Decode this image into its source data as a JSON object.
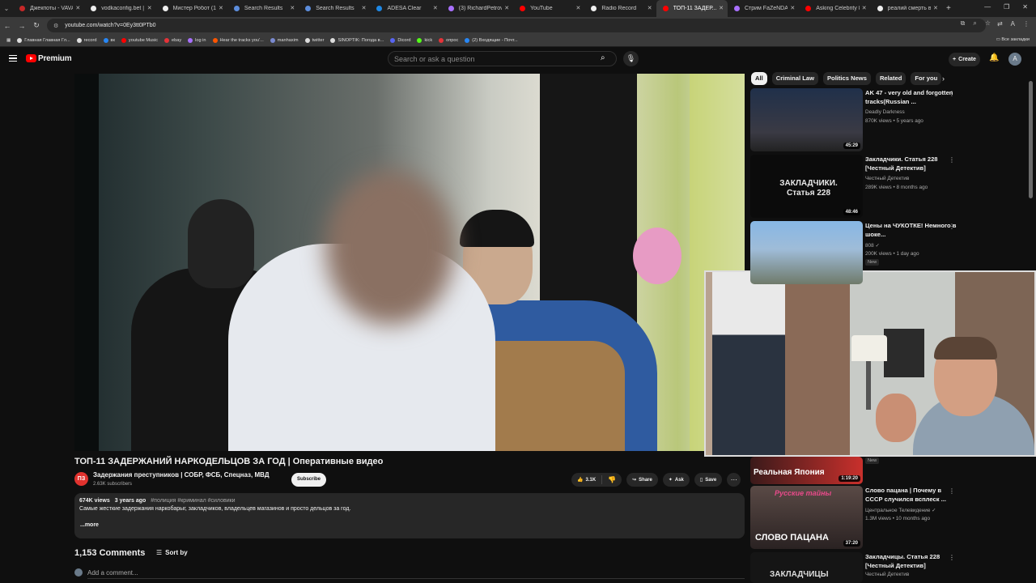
{
  "tabs": [
    {
      "label": "Джекпоты - VAVAD",
      "color": "#c62828"
    },
    {
      "label": "vodkaconfig.bet | 5...",
      "color": "#eee"
    },
    {
      "label": "Мистер Робот (1-4...",
      "color": "#eee"
    },
    {
      "label": "Search Results",
      "color": "#5c8ddc"
    },
    {
      "label": "Search Results",
      "color": "#5c8ddc"
    },
    {
      "label": "ADESA Clear",
      "color": "#1e88e5"
    },
    {
      "label": "(3) RichardPetrovic...",
      "color": "#a970ff"
    },
    {
      "label": "YouTube",
      "color": "#ff0000"
    },
    {
      "label": "Radio Record",
      "color": "#eee"
    },
    {
      "label": "ТОП-11 ЗАДЕР...",
      "color": "#ff0000"
    },
    {
      "label": "Стрим FaZeNDA67",
      "color": "#a970ff"
    },
    {
      "label": "Asking Celebrity 8...",
      "color": "#ff0000"
    },
    {
      "label": "реалий смерть в ...",
      "color": "#eee"
    }
  ],
  "address": {
    "url": "youtube.com/watch?v=0Ey3tt0PTb0"
  },
  "bookmarks": [
    {
      "label": "Главная Главная Гл...",
      "color": "#ddd"
    },
    {
      "label": "record",
      "color": "#ddd"
    },
    {
      "label": "вк",
      "color": "#2787f5"
    },
    {
      "label": "youtube Music",
      "color": "#ff0000"
    },
    {
      "label": "ebay",
      "color": "#e53238"
    },
    {
      "label": "log in",
      "color": "#a970ff"
    },
    {
      "label": "Hear the tracks you'...",
      "color": "#ff5500"
    },
    {
      "label": "manhaxim",
      "color": "#7a8ad0"
    },
    {
      "label": "twitter",
      "color": "#ddd"
    },
    {
      "label": "SINOPTIK: Погода в...",
      "color": "#ddd"
    },
    {
      "label": "Dicord",
      "color": "#5865f2"
    },
    {
      "label": "kick",
      "color": "#53fc18"
    },
    {
      "label": "опрос",
      "color": "#e53238"
    },
    {
      "label": "(2) Входящие - Почт...",
      "color": "#2787f5"
    }
  ],
  "bookmarks_all": "Все закладки",
  "header": {
    "logo_text": "Premium",
    "search_placeholder": "Search or ask a question",
    "create_label": "Create"
  },
  "video": {
    "title": "ТОП-11 ЗАДЕРЖАНИЙ НАРКОДЕЛЬЦОВ ЗА ГОД | Оперативные видео",
    "channel": "Задержания преступников | СОБР, ФСБ, Спецназ, МВД",
    "channel_abbr": "ПЗ",
    "subscribers": "2.63K subscribers",
    "subscribe_label": "Subscribe",
    "likes": "3.1K",
    "share_label": "Share",
    "ask_label": "Ask",
    "save_label": "Save",
    "views": "674K views",
    "age": "3 years ago",
    "tags": "#полиция #криминал #силовики",
    "description": "Самые жесткие задержания наркобарыг, закладчиков, владельцев магазинов и просто дельцов за год.",
    "more_label": "...more"
  },
  "comments": {
    "count": "1,153 Comments",
    "sort_label": "Sort by",
    "add_placeholder": "Add a comment..."
  },
  "chips": [
    {
      "label": "All",
      "active": true
    },
    {
      "label": "Criminal Law",
      "active": false
    },
    {
      "label": "Politics News",
      "active": false
    },
    {
      "label": "Related",
      "active": false
    },
    {
      "label": "For you",
      "active": false
    }
  ],
  "recommendations": [
    {
      "title": "AK 47 - very old and forgotten tracks(Russian ...",
      "channel": "Deadly Darkness",
      "meta": "870K views • 5 years ago",
      "duration": "45:29",
      "badge": ""
    },
    {
      "title": "Закладчики. Статья 228 [Честный Детектив]",
      "channel": "Честный Детектив",
      "meta": "289K views • 8 months ago",
      "duration": "48:46",
      "badge": "",
      "thumb_text": "ЗАКЛАДЧИКИ. Статья 228"
    },
    {
      "title": "Цены на ЧУКОТКЕ! Немного в шоке...",
      "channel": "808 ✓",
      "meta": "200K views • 1 day ago",
      "duration": "",
      "badge": "New"
    },
    {
      "title": "",
      "channel": "",
      "meta": "",
      "duration": "1:19:20",
      "badge": "New",
      "thumb_text": "Реальная Япония"
    },
    {
      "title": "Слово пацана | Почему в СССР случился всплеск ...",
      "channel": "Центральное Телевидение ✓",
      "meta": "1.3M views • 10 months ago",
      "duration": "37:20",
      "badge": "",
      "thumb_text": "СЛОВО ПАЦАНА",
      "thumb_text2": "Русские тайны"
    },
    {
      "title": "Закладчицы. Статья 228 [Честный Детектив]",
      "channel": "Честный Детектив",
      "meta": "",
      "duration": "",
      "badge": "",
      "thumb_text": "ЗАКЛАДЧИЦЫ"
    }
  ]
}
